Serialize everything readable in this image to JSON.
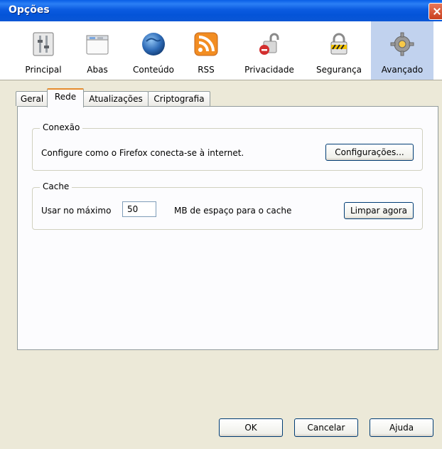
{
  "window": {
    "title": "Opções"
  },
  "toolbar": {
    "items": [
      {
        "label": "Principal",
        "icon": "principal-icon"
      },
      {
        "label": "Abas",
        "icon": "tabs-icon"
      },
      {
        "label": "Conteúdo",
        "icon": "globe-icon"
      },
      {
        "label": "RSS",
        "icon": "rss-icon"
      },
      {
        "label": "Privacidade",
        "icon": "lock-open-icon"
      },
      {
        "label": "Segurança",
        "icon": "padlock-icon"
      },
      {
        "label": "Avançado",
        "icon": "gear-icon"
      }
    ],
    "selected": "Avançado"
  },
  "tabs": [
    {
      "label": "Geral"
    },
    {
      "label": "Rede"
    },
    {
      "label": "Atualizações"
    },
    {
      "label": "Criptografia"
    }
  ],
  "active_tab": "Rede",
  "connection": {
    "legend": "Conexão",
    "description": "Configure como o Firefox conecta-se à internet.",
    "settings_button": "Configurações..."
  },
  "cache": {
    "legend": "Cache",
    "label_before": "Usar no máximo",
    "value": "50",
    "label_after": "MB de espaço para o cache",
    "clear_button": "Limpar agora"
  },
  "footer": {
    "ok": "OK",
    "cancel": "Cancelar",
    "help": "Ajuda"
  },
  "colors": {
    "titlebar": "#0454d8",
    "selected_toolbar": "#c1d2ee",
    "active_tab_accent": "#e68b2c"
  }
}
